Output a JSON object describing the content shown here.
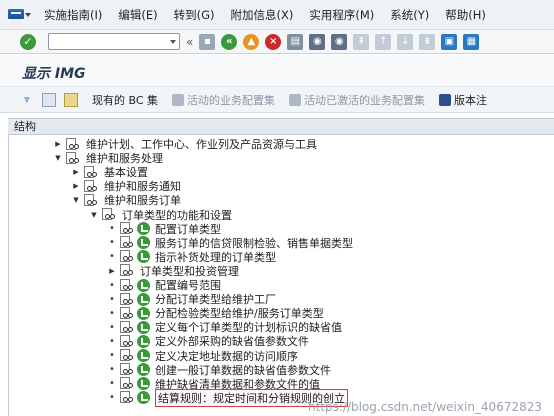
{
  "menubar": {
    "items": [
      {
        "label": "实施指南(I)"
      },
      {
        "label": "编辑(E)"
      },
      {
        "label": "转到(G)"
      },
      {
        "label": "附加信息(X)"
      },
      {
        "label": "实用程序(M)"
      },
      {
        "label": "系统(Y)"
      },
      {
        "label": "帮助(H)"
      }
    ]
  },
  "toolbar": {
    "ok_symbol": "✓",
    "command_value": "",
    "collapse_symbol": "«"
  },
  "page": {
    "title": "显示 IMG"
  },
  "apptoolbar": {
    "bc_sets_label": "现有的 BC 集",
    "active_bc_label": "活动的业务配置集",
    "activated_bc_label": "活动已激活的业务配置集",
    "release_label": "版本注"
  },
  "tree": {
    "header": "结构",
    "rows": [
      {
        "label": "维护计划、工作中心、作业列及产品资源与工具",
        "level": 1,
        "node": "collapsed",
        "activity": false
      },
      {
        "label": "维护和服务处理",
        "level": 1,
        "node": "expanded",
        "activity": false
      },
      {
        "label": "基本设置",
        "level": 2,
        "node": "collapsed",
        "activity": false
      },
      {
        "label": "维护和服务通知",
        "level": 2,
        "node": "collapsed",
        "activity": false
      },
      {
        "label": "维护和服务订单",
        "level": 2,
        "node": "expanded",
        "activity": false
      },
      {
        "label": "订单类型的功能和设置",
        "level": 3,
        "node": "expanded",
        "activity": false
      },
      {
        "label": "配置订单类型",
        "level": 4,
        "node": "leaf",
        "activity": true
      },
      {
        "label": "服务订单的信贷限制检验、销售单据类型",
        "level": 4,
        "node": "leaf",
        "activity": true
      },
      {
        "label": "指示补货处理的订单类型",
        "level": 4,
        "node": "leaf",
        "activity": true
      },
      {
        "label": "订单类型和投资管理",
        "level": 4,
        "node": "collapsed",
        "activity": false
      },
      {
        "label": "配置编号范围",
        "level": 4,
        "node": "leaf",
        "activity": true
      },
      {
        "label": "分配订单类型给维护工厂",
        "level": 4,
        "node": "leaf",
        "activity": true
      },
      {
        "label": "分配检验类型给维护/服务订单类型",
        "level": 4,
        "node": "leaf",
        "activity": true
      },
      {
        "label": "定义每个订单类型的计划标识的缺省值",
        "level": 4,
        "node": "leaf",
        "activity": true
      },
      {
        "label": "定义外部采购的缺省值参数文件",
        "level": 4,
        "node": "leaf",
        "activity": true
      },
      {
        "label": "定义决定地址数据的访问顺序",
        "level": 4,
        "node": "leaf",
        "activity": true
      },
      {
        "label": "创建一般订单数据的缺省值参数文件",
        "level": 4,
        "node": "leaf",
        "activity": true
      },
      {
        "label": "维护缺省清单数据和参数文件的值",
        "level": 4,
        "node": "leaf",
        "activity": true
      },
      {
        "label": "结算规则：规定时间和分销规则的创立",
        "level": 4,
        "node": "leaf",
        "activity": true,
        "selected": true
      }
    ]
  },
  "watermark": "https://blog.csdn.net/weixin_40672823"
}
